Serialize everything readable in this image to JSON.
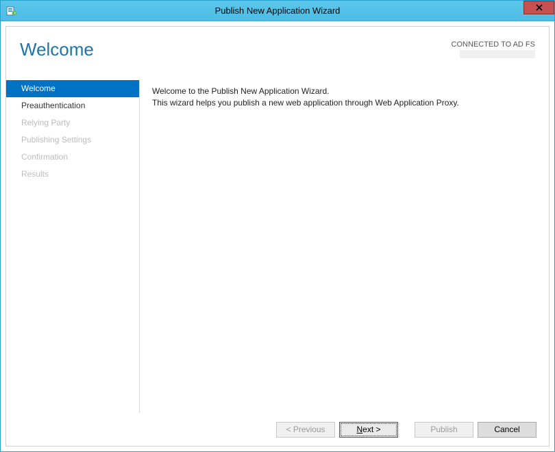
{
  "window": {
    "title": "Publish New Application Wizard"
  },
  "header": {
    "page_title": "Welcome",
    "connection_status": "CONNECTED TO AD FS"
  },
  "sidebar": {
    "items": [
      {
        "label": "Welcome",
        "state": "active"
      },
      {
        "label": "Preauthentication",
        "state": "enabled"
      },
      {
        "label": "Relying Party",
        "state": "disabled"
      },
      {
        "label": "Publishing Settings",
        "state": "disabled"
      },
      {
        "label": "Confirmation",
        "state": "disabled"
      },
      {
        "label": "Results",
        "state": "disabled"
      }
    ]
  },
  "content": {
    "line1": "Welcome to the Publish New Application Wizard.",
    "line2": "This wizard helps you publish a new web application through Web Application Proxy."
  },
  "buttons": {
    "previous": "< Previous",
    "next": "Next >",
    "publish": "Publish",
    "cancel": "Cancel"
  }
}
